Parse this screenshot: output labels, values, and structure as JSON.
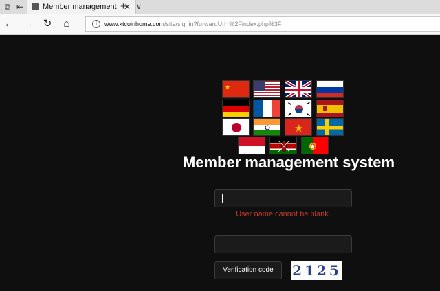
{
  "browser": {
    "tab_title": "Member management s",
    "url_host": "www.ktcoinhome.com",
    "url_path": "/site/signin?forwardUrl=%2Findex.php%3F"
  },
  "page": {
    "title": "Member management system",
    "username_error": "User name cannot be blank.",
    "verification_button": "Verification code",
    "captcha_text": "2125"
  },
  "flags": [
    "China",
    "United States",
    "United Kingdom",
    "Russia",
    "Germany",
    "France",
    "South Korea",
    "Spain",
    "Japan",
    "India",
    "Vietnam",
    "Sweden",
    "Indonesia",
    "Kenya",
    "Portugal"
  ],
  "colors": {
    "background": "#0f0f0f",
    "error": "#c0392b",
    "captcha_text": "#26408b"
  }
}
